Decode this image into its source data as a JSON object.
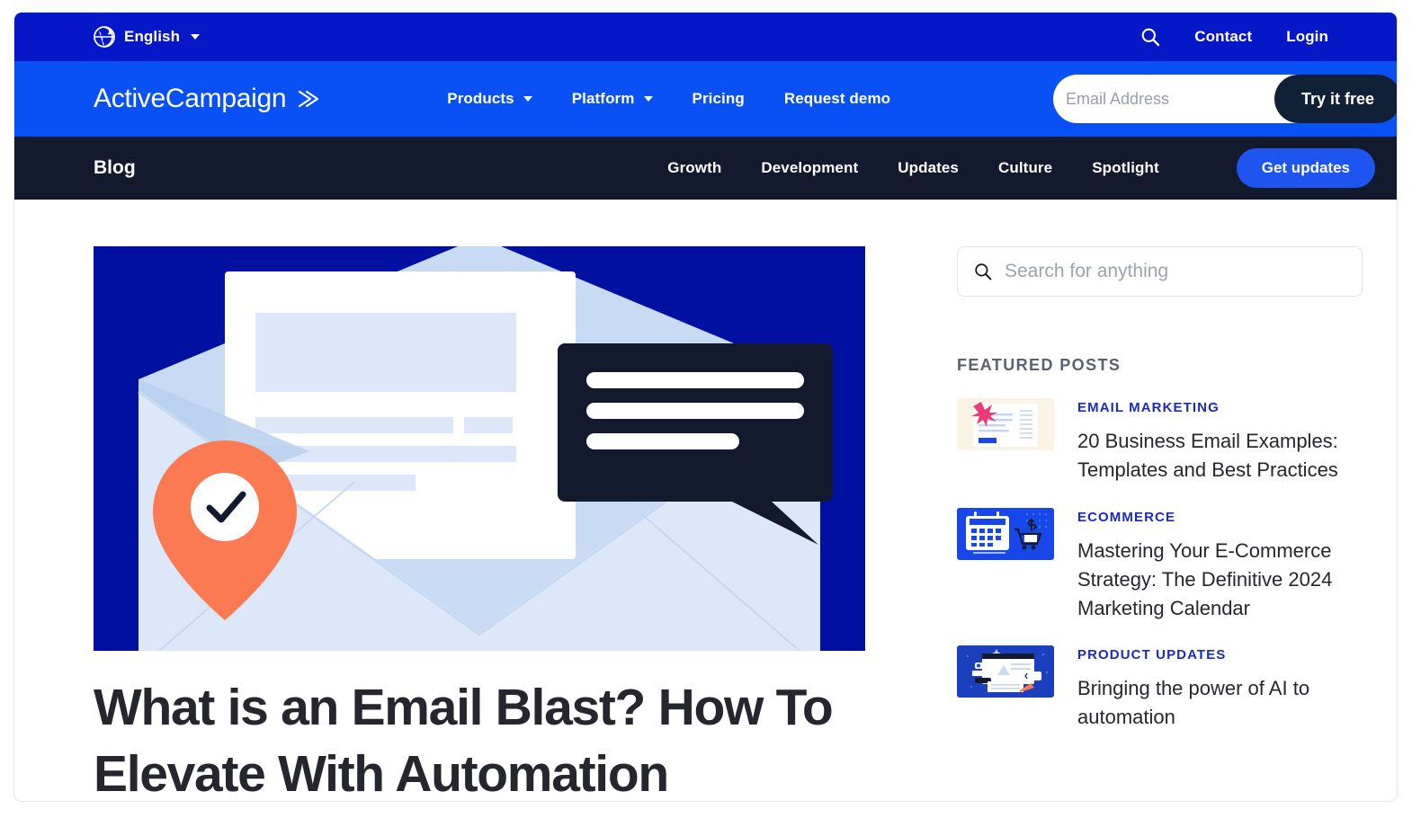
{
  "colors": {
    "utility_bar_bg": "#0517C7",
    "main_nav_bg": "#0A51F5",
    "blog_nav_bg": "#141A2E",
    "hero_bg": "#0010A0",
    "accent_orange": "#FB7A52",
    "accent_blue": "#1E55F0",
    "kicker_blue": "#1A2BBF",
    "dark_navy": "#122037"
  },
  "utility_bar": {
    "globe_icon": "globe-icon",
    "language": "English",
    "language_caret": "chevron-down-icon",
    "search_icon": "search-icon",
    "links": [
      {
        "label": "Contact"
      },
      {
        "label": "Login"
      }
    ]
  },
  "main_nav": {
    "logo_text": "ActiveCampaign",
    "logo_mark": "chevron-double-right-icon",
    "items": [
      {
        "label": "Products",
        "has_caret": true
      },
      {
        "label": "Platform",
        "has_caret": true
      },
      {
        "label": "Pricing",
        "has_caret": false
      },
      {
        "label": "Request demo",
        "has_caret": false
      }
    ],
    "email_placeholder": "Email Address",
    "email_value": "",
    "cta_label": "Try it free"
  },
  "blog_nav": {
    "brand": "Blog",
    "items": [
      {
        "label": "Growth"
      },
      {
        "label": "Development"
      },
      {
        "label": "Updates"
      },
      {
        "label": "Culture"
      },
      {
        "label": "Spotlight"
      }
    ],
    "cta_label": "Get updates"
  },
  "article": {
    "title": "What is an Email Blast? How To Elevate With Automation",
    "hero_illustration": "email-envelope-with-checkmark-pin-and-chat-bubble"
  },
  "sidebar": {
    "search": {
      "icon": "search-icon",
      "placeholder": "Search for anything",
      "value": ""
    },
    "featured_heading": "FEATURED POSTS",
    "featured_posts": [
      {
        "category": "EMAIL MARKETING",
        "title": "20 Business Email Examples: Templates and Best Practices",
        "thumbnail": "email-template-with-pink-starburst"
      },
      {
        "category": "ECOMMERCE",
        "title": "Mastering Your E-Commerce Strategy: The Definitive 2024 Marketing Calendar",
        "thumbnail": "ecommerce-calendar-with-shopping-cart"
      },
      {
        "category": "PRODUCT UPDATES",
        "title": "Bringing the power of AI to automation",
        "thumbnail": "ai-automation-dashboard"
      }
    ]
  }
}
